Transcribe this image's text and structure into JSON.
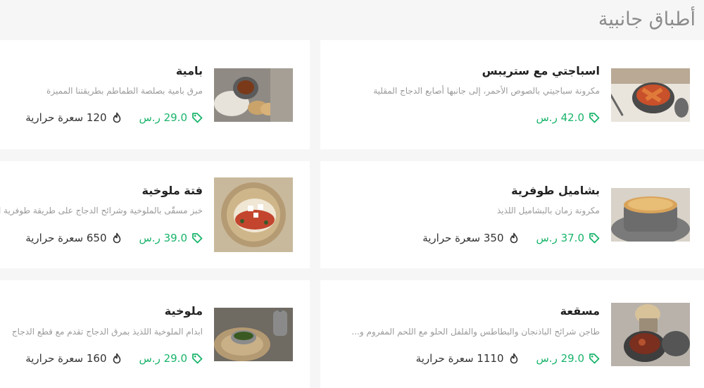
{
  "section": {
    "title": "أطباق جانبية"
  },
  "items": [
    {
      "name": "اسباجتي مع ستريبس",
      "desc": "مكرونة سباجيتي بالصوص الأحمر، إلى جانبها أصابع الدجاج المقلية",
      "price": "42.0 ر.س",
      "calories": ""
    },
    {
      "name": "بامية",
      "desc": "مرق بامية بصلصة الطماطم بطريقتنا المميزة",
      "price": "29.0 ر.س",
      "calories": "120 سعرة حرارية"
    },
    {
      "name": "بشاميل طوفرية",
      "desc": "مكرونة زمان بالبشاميل اللذيذ",
      "price": "37.0 ر.س",
      "calories": "350 سعرة حرارية"
    },
    {
      "name": "فتة ملوخية",
      "desc": "خبز مسقّى بالملوخية وشرائح الدجاج على طريقة طوفرية الخ",
      "price": "39.0 ر.س",
      "calories": "650 سعرة حرارية"
    },
    {
      "name": "مسقعة",
      "desc": "طاجن شرائح الباذنجان والبطاطس والفلفل الحلو مع اللحم المفروم و...",
      "price": "29.0 ر.س",
      "calories": "1110 سعرة حرارية"
    },
    {
      "name": "ملوخية",
      "desc": "ابدام الملوخية اللذيذ بمرق الدجاج تقدم مع قطع الدجاج",
      "price": "29.0 ر.س",
      "calories": "160 سعرة حرارية"
    }
  ],
  "icons": {
    "price": "tag-icon",
    "calories": "flame-icon"
  },
  "colors": {
    "price": "#19b46b",
    "title": "#8b8b8b",
    "text": "#222222",
    "desc": "#9a9a9a"
  }
}
